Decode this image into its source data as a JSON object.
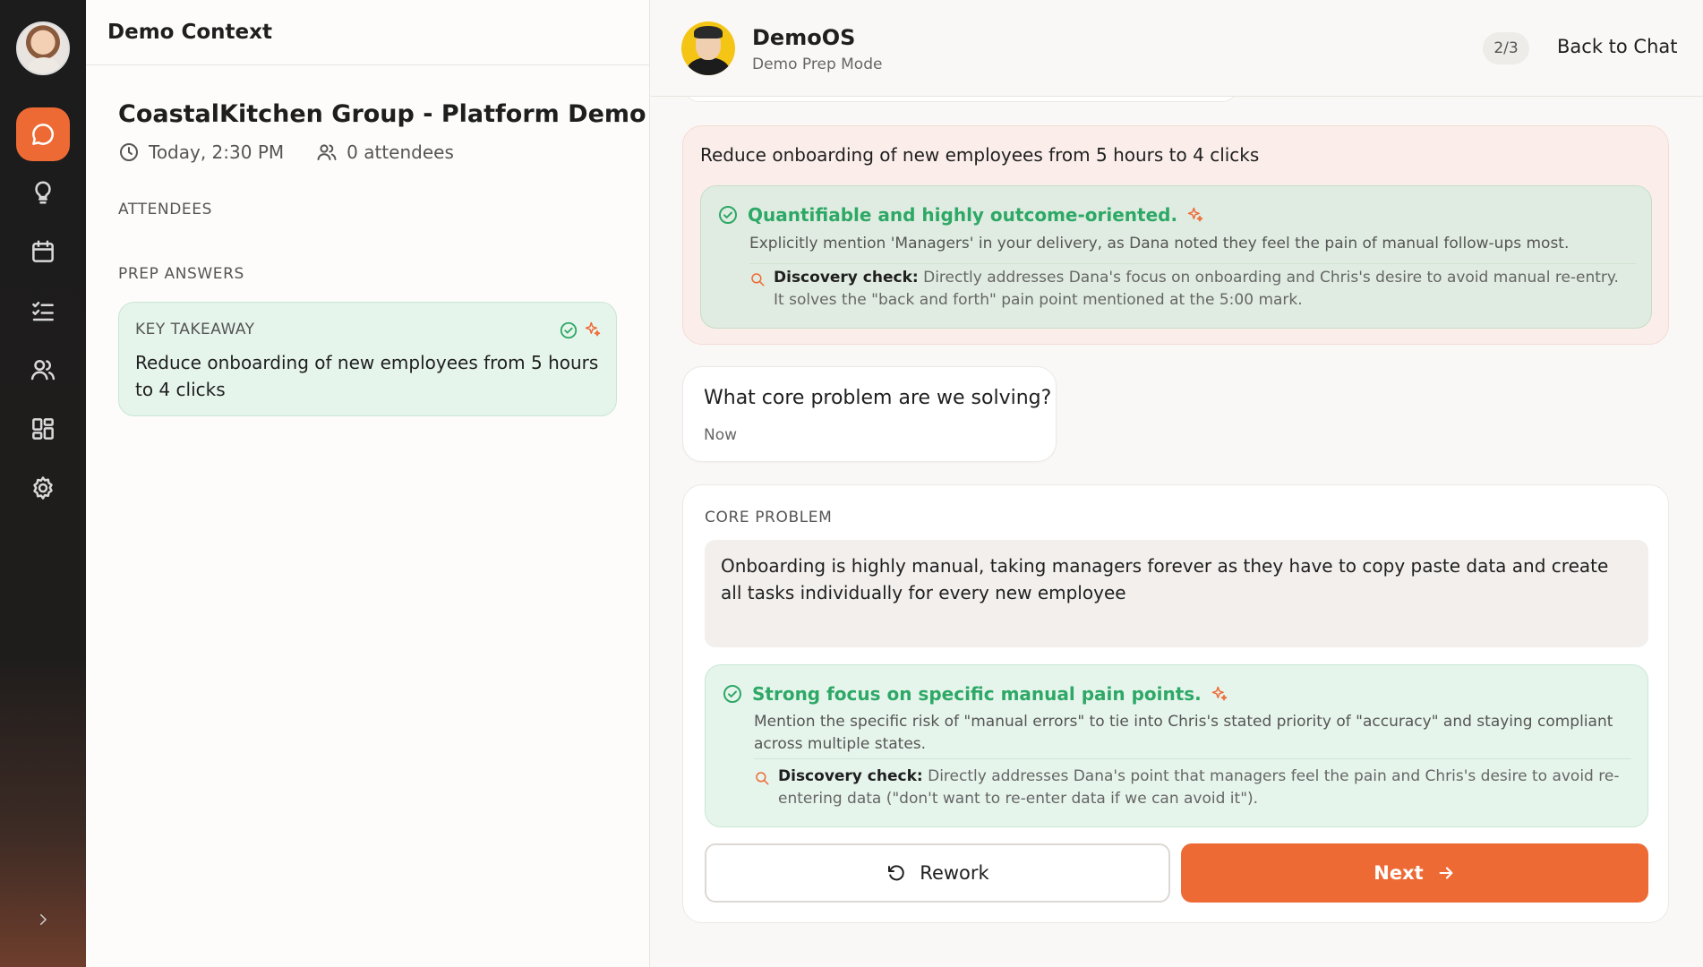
{
  "rail": {
    "items": [
      {
        "icon": "chat-icon",
        "active": true
      },
      {
        "icon": "lightbulb-icon",
        "active": false
      },
      {
        "icon": "calendar-icon",
        "active": false
      },
      {
        "icon": "checklist-icon",
        "active": false
      },
      {
        "icon": "users-icon",
        "active": false
      },
      {
        "icon": "grid-icon",
        "active": false
      },
      {
        "icon": "gear-icon",
        "active": false
      }
    ],
    "accent": "#ee6a35"
  },
  "context": {
    "header": "Demo Context",
    "title": "CoastalKitchen Group - Platform Demo",
    "time": "Today, 2:30 PM",
    "attendees_count": "0 attendees",
    "attendees_label": "ATTENDEES",
    "prep_label": "PREP ANSWERS",
    "takeaway": {
      "label": "KEY TAKEAWAY",
      "text": "Reduce onboarding of new employees from 5 hours to 4 clicks"
    }
  },
  "chat": {
    "bot_name": "DemoOS",
    "bot_mode": "Demo Prep Mode",
    "progress": "2/3",
    "back": "Back to Chat",
    "answer": {
      "text": "Reduce onboarding of new employees from 5 hours to 4 clicks",
      "feedback_title": "Quantifiable and highly outcome-oriented.",
      "feedback_body": "Explicitly mention 'Managers' in your delivery, as Dana noted they feel the pain of manual follow-ups most.",
      "discovery_label": "Discovery check:",
      "discovery_text": "Directly addresses Dana's focus on onboarding and Chris's desire to avoid manual re-entry. It solves the \"back and forth\" pain point mentioned at the 5:00 mark."
    },
    "question": {
      "text": "What core problem are we solving?",
      "time": "Now"
    },
    "core": {
      "label": "CORE PROBLEM",
      "text": "Onboarding is highly manual, taking managers forever as they have to copy paste data and create all tasks individually for every new employee",
      "feedback_title": "Strong focus on specific manual pain points.",
      "feedback_body": "Mention the specific risk of \"manual errors\" to tie into Chris's stated priority of \"accuracy\" and staying compliant across multiple states.",
      "discovery_label": "Discovery check:",
      "discovery_text": "Directly addresses Dana's point that managers feel the pain and Chris's desire to avoid re-entering data (\"don't want to re-enter data if we can avoid it\")."
    },
    "buttons": {
      "rework": "Rework",
      "next": "Next"
    },
    "colors": {
      "success": "#2ea866",
      "primary": "#ee6a35"
    }
  }
}
